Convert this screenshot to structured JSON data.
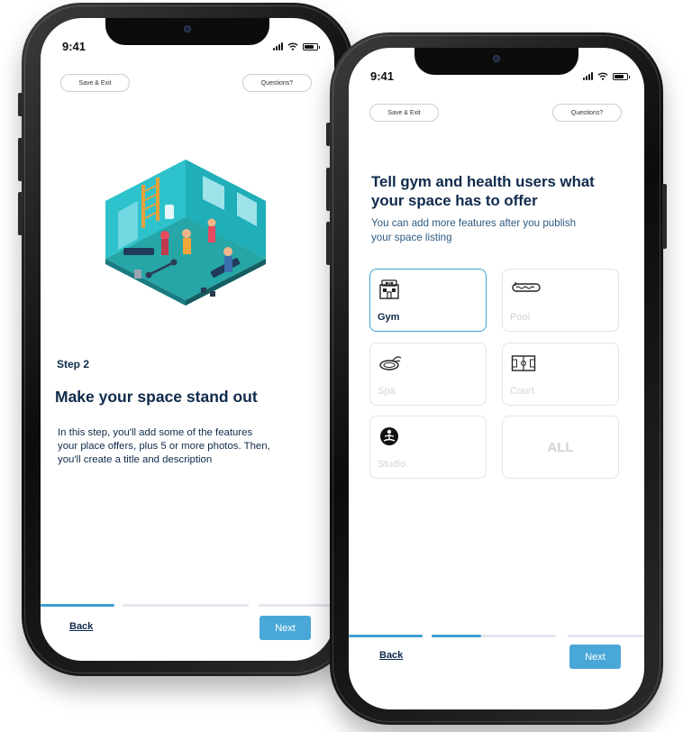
{
  "left_screen": {
    "status_time": "9:41",
    "save_exit_label": "Save & Exit",
    "questions_label": "Questions?",
    "step_label": "Step 2",
    "heading": "Make your space stand out",
    "body_lines": [
      "In this step, you'll add some of the features",
      "your place offers, plus 5 or more photos. Then,",
      "you'll create a title and description"
    ],
    "back_label": "Back",
    "next_label": "Next",
    "progress_completed_fraction": 1.0
  },
  "right_screen": {
    "status_time": "9:41",
    "save_exit_label": "Save & Exit",
    "questions_label": "Questions?",
    "title_lines": [
      "Tell gym and health users what",
      "your space has to offer"
    ],
    "subtitle_lines": [
      "You can add more features after you publish",
      "your space listing"
    ],
    "features": [
      {
        "label": "Gym",
        "icon": "gym-building-icon",
        "selected": true
      },
      {
        "label": "Pool",
        "icon": "pool-icon",
        "selected": false
      },
      {
        "label": "Spa",
        "icon": "spa-icon",
        "selected": false
      },
      {
        "label": "Court",
        "icon": "court-icon",
        "selected": false
      },
      {
        "label": "Studio",
        "icon": "yoga-studio-icon",
        "selected": false
      }
    ],
    "all_label": "ALL",
    "back_label": "Back",
    "next_label": "Next",
    "progress_completed_fraction": 0.4
  },
  "colors": {
    "accent": "#3e9fd1",
    "button": "#4aa8d8",
    "heading": "#0f2a4a",
    "muted": "#d0d3d8"
  }
}
